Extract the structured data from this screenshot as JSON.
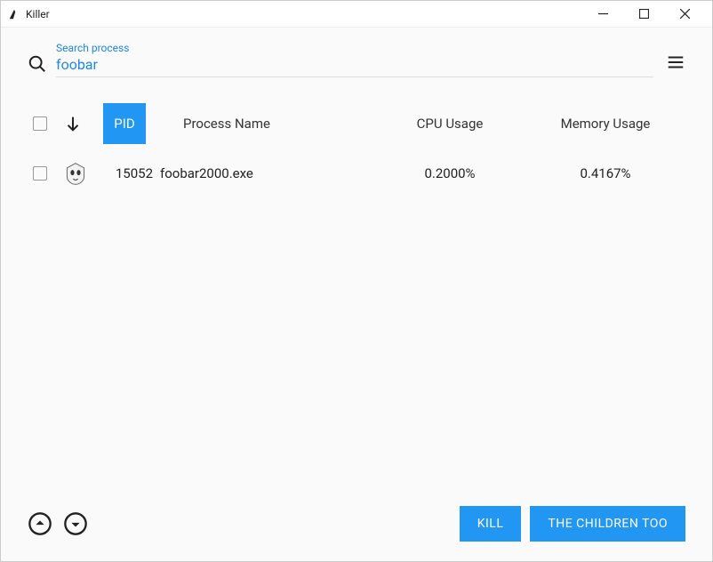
{
  "window": {
    "title": "Killer"
  },
  "search": {
    "label": "Search process",
    "value": "foobar"
  },
  "columns": {
    "pid": "PID",
    "name": "Process Name",
    "cpu": "CPU Usage",
    "mem": "Memory Usage"
  },
  "rows": [
    {
      "pid": "15052",
      "name": "foobar2000.exe",
      "cpu": "0.2000%",
      "mem": "0.4167%"
    }
  ],
  "buttons": {
    "kill": "KILL",
    "children": "THE CHILDREN TOO"
  },
  "colors": {
    "accent": "#2196f3"
  }
}
